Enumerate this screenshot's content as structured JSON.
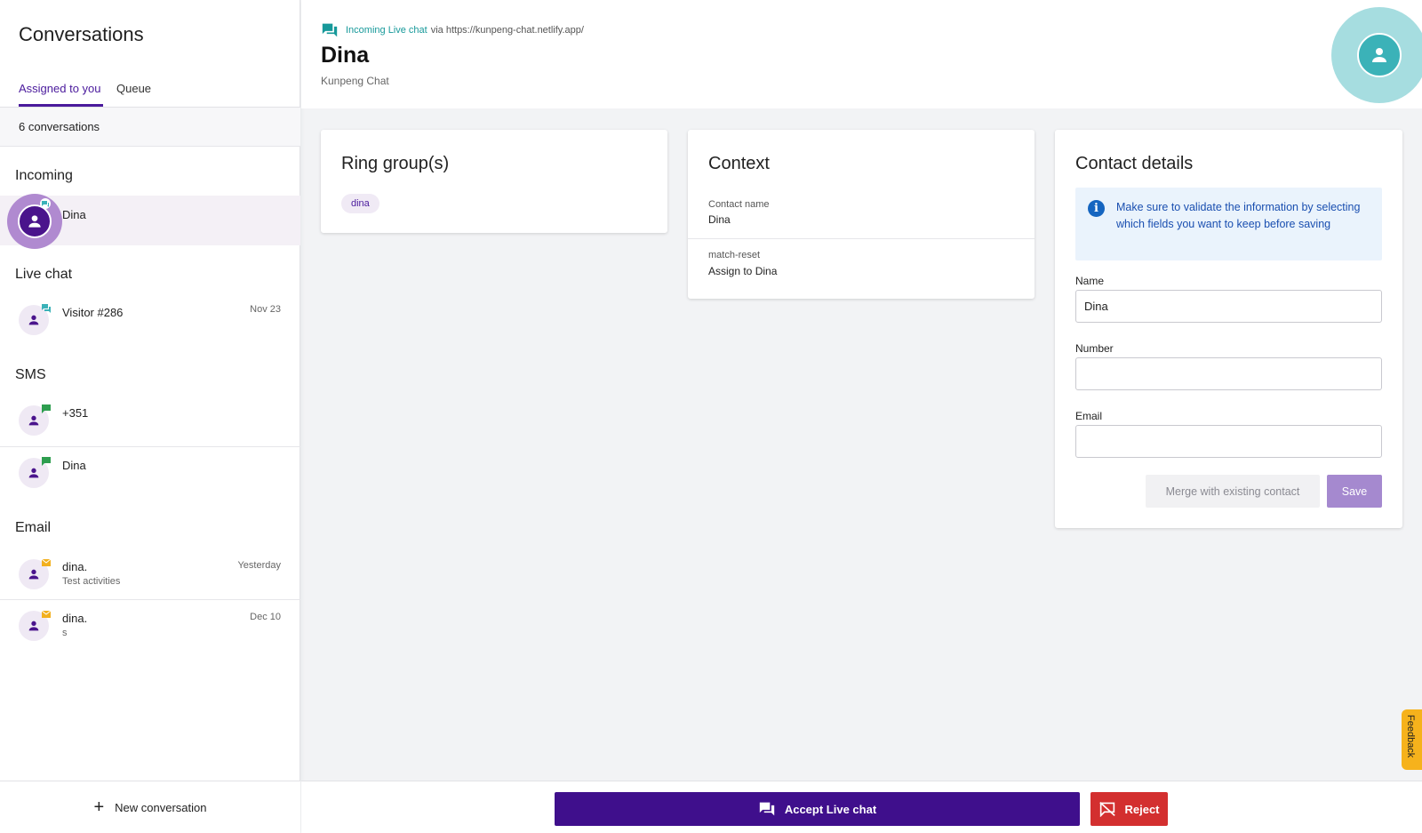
{
  "sidebar": {
    "title": "Conversations",
    "tabs": [
      {
        "label": "Assigned to you",
        "active": true
      },
      {
        "label": "Queue",
        "active": false
      }
    ],
    "count_label": "6 conversations",
    "sections": [
      {
        "title": "Incoming",
        "items": [
          {
            "name": "Dina",
            "sub": "",
            "date": "",
            "channel": "chat",
            "selected": true
          }
        ]
      },
      {
        "title": "Live chat",
        "items": [
          {
            "name": "Visitor #286",
            "sub": "",
            "date": "Nov 23",
            "channel": "chat"
          }
        ]
      },
      {
        "title": "SMS",
        "items": [
          {
            "name": "+351",
            "sub": "",
            "date": "",
            "channel": "sms"
          },
          {
            "name": "Dina",
            "sub": "",
            "date": "",
            "channel": "sms"
          }
        ]
      },
      {
        "title": "Email",
        "items": [
          {
            "name": "dina.",
            "sub": "Test activities",
            "date": "Yesterday",
            "channel": "email"
          },
          {
            "name": "dina.",
            "sub": "s",
            "date": "Dec 10",
            "channel": "email"
          }
        ]
      }
    ],
    "new_conversation_label": "New conversation"
  },
  "header": {
    "channel_link": "Incoming Live chat",
    "via_text": "via https://kunpeng-chat.netlify.app/",
    "name": "Dina",
    "subtitle": "Kunpeng Chat"
  },
  "ring_groups": {
    "title": "Ring group(s)",
    "chips": [
      "dina"
    ]
  },
  "context": {
    "title": "Context",
    "rows": [
      {
        "label": "Contact name",
        "value": "Dina"
      },
      {
        "label": "match-reset",
        "value": "Assign to Dina"
      }
    ]
  },
  "contact_details": {
    "title": "Contact details",
    "info": "Make sure to validate the information by selecting which fields you want to keep before saving",
    "fields": [
      {
        "label": "Name",
        "value": "Dina",
        "placeholder": ""
      },
      {
        "label": "Number",
        "value": "",
        "placeholder": ""
      },
      {
        "label": "Email",
        "value": "",
        "placeholder": ""
      }
    ],
    "merge_label": "Merge with existing contact",
    "save_label": "Save"
  },
  "footer": {
    "accept_label": "Accept Live chat",
    "reject_label": "Reject"
  },
  "feedback_label": "Feedback",
  "colors": {
    "brand": "#3f0f8c",
    "accent_teal": "#17999a",
    "reject": "#d32f2f",
    "chat_badge": "#3bb2b8",
    "sms_badge": "#2e9e4f",
    "email_badge": "#f2b01e"
  }
}
